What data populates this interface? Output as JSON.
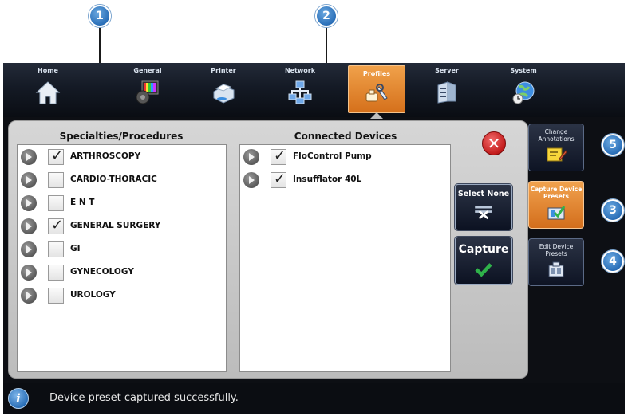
{
  "callouts": [
    "1",
    "2",
    "3",
    "4",
    "5"
  ],
  "nav": {
    "tabs": [
      {
        "label": "Home",
        "icon": "home-icon"
      },
      {
        "label": "General",
        "icon": "general-icon"
      },
      {
        "label": "Printer",
        "icon": "printer-icon"
      },
      {
        "label": "Network",
        "icon": "network-icon"
      },
      {
        "label": "Profiles",
        "icon": "profiles-icon",
        "active": true
      },
      {
        "label": "Server",
        "icon": "server-icon"
      },
      {
        "label": "System",
        "icon": "system-icon"
      }
    ]
  },
  "specialties": {
    "heading": "Specialties/Procedures",
    "items": [
      {
        "label": "ARTHROSCOPY",
        "checked": true
      },
      {
        "label": "CARDIO-THORACIC",
        "checked": false
      },
      {
        "label": "E N T",
        "checked": false
      },
      {
        "label": "GENERAL SURGERY",
        "checked": true
      },
      {
        "label": "GI",
        "checked": false
      },
      {
        "label": "GYNECOLOGY",
        "checked": false
      },
      {
        "label": "UROLOGY",
        "checked": false
      }
    ]
  },
  "devices": {
    "heading": "Connected Devices",
    "items": [
      {
        "label": "FloControl Pump",
        "checked": true
      },
      {
        "label": "Insufflator 40L",
        "checked": true
      }
    ]
  },
  "actions": {
    "select_none": "Select None",
    "capture": "Capture"
  },
  "side_tools": {
    "change_annotations": "Change Annotations",
    "capture_presets": "Capture Device Presets",
    "edit_presets": "Edit Device Presets"
  },
  "status": {
    "message": "Device preset captured successfully."
  },
  "colors": {
    "accent_orange": "#e2862f",
    "callout_blue": "#2a6fb8",
    "close_red": "#c21b1b",
    "capture_green": "#2fb24a"
  }
}
